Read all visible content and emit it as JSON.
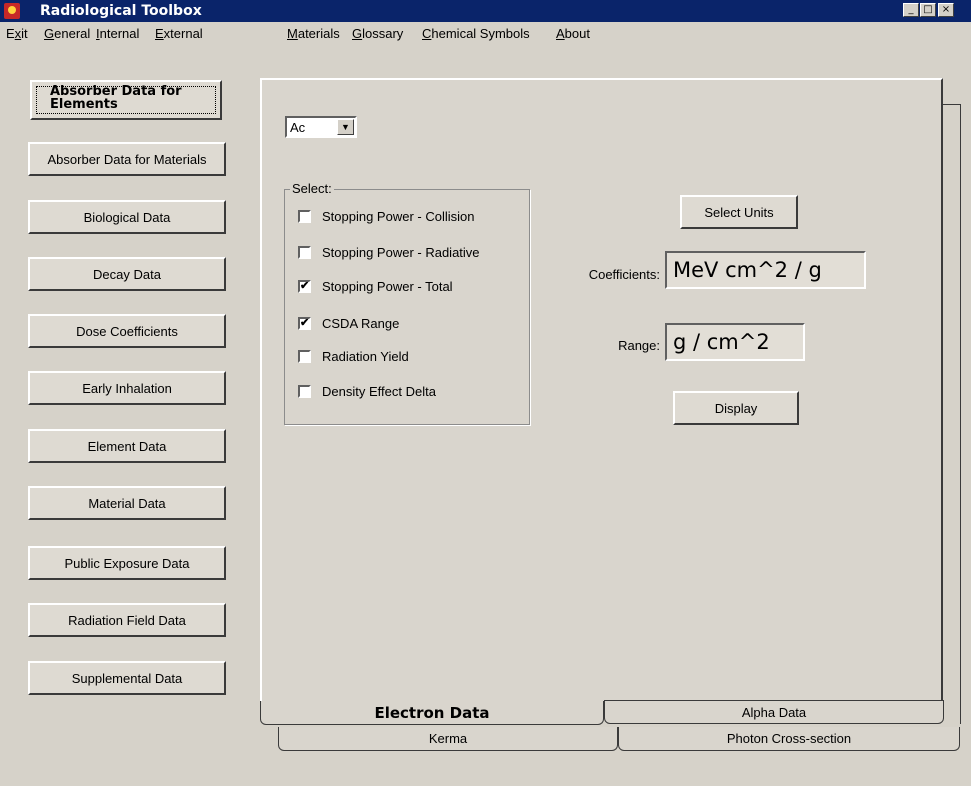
{
  "window": {
    "title": "Radiological Toolbox",
    "controls": {
      "minimize": "_",
      "maximize": "□",
      "close": "×"
    }
  },
  "menu": [
    {
      "label": "Exit",
      "accel_index": 1
    },
    {
      "label": "General",
      "accel_index": 0
    },
    {
      "label": "Internal",
      "accel_index": 0
    },
    {
      "label": "External",
      "accel_index": 0
    },
    {
      "label": "Materials",
      "accel_index": 0
    },
    {
      "label": "Glossary",
      "accel_index": 0
    },
    {
      "label": "Chemical Symbols",
      "accel_index": 0
    },
    {
      "label": "About",
      "accel_index": 0
    }
  ],
  "sidebar": {
    "items": [
      {
        "label": "Absorber Data for Elements",
        "active": true
      },
      {
        "label": "Absorber Data for Materials"
      },
      {
        "label": "Biological Data"
      },
      {
        "label": "Decay Data"
      },
      {
        "label": "Dose Coefficients"
      },
      {
        "label": "Early Inhalation"
      },
      {
        "label": "Element Data"
      },
      {
        "label": "Material Data"
      },
      {
        "label": "Public Exposure Data"
      },
      {
        "label": "Radiation Field Data"
      },
      {
        "label": "Supplemental Data"
      }
    ]
  },
  "element_select": {
    "value": "Ac",
    "arrow": "▼"
  },
  "select_group": {
    "label": "Select:",
    "options": [
      {
        "label": "Stopping Power - Collision",
        "checked": false
      },
      {
        "label": "Stopping Power - Radiative",
        "checked": false
      },
      {
        "label": "Stopping Power - Total",
        "checked": true
      },
      {
        "label": "CSDA Range",
        "checked": true
      },
      {
        "label": "Radiation Yield",
        "checked": false
      },
      {
        "label": "Density Effect Delta",
        "checked": false
      }
    ],
    "check_glyph": "✔"
  },
  "units": {
    "select_button": "Select Units",
    "coefficients_label": "Coefficients:",
    "coefficients_value": "MeV cm^2 /  g",
    "range_label": "Range:",
    "range_value": "g / cm^2",
    "display_button": "Display"
  },
  "tabs": {
    "front": [
      "Electron Data",
      "Alpha Data"
    ],
    "back": [
      "Kerma",
      "Photon Cross-section"
    ],
    "active": "Electron Data"
  }
}
